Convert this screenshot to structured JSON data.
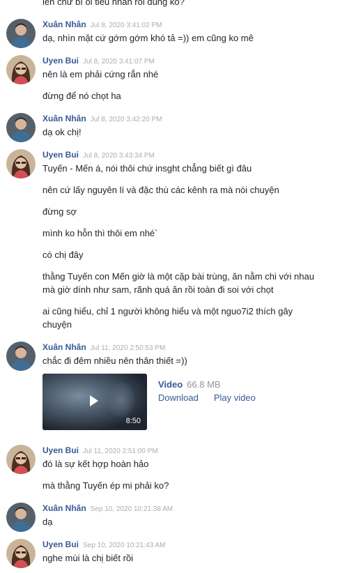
{
  "colors": {
    "name": "#385898",
    "time": "#a8acb3",
    "link": "#385898"
  },
  "groups": [
    {
      "sender": "",
      "time": "",
      "messages": [
        "lên chữ bí ổi tiểu nhân rồi đúng ko?"
      ]
    },
    {
      "sender": "Xuân Nhân",
      "time": "Jul 8, 2020 3:41:02 PM",
      "messages": [
        "dạ, nhìn mặt cứ gớm gớm khó tả =)) em cũng ko mê"
      ]
    },
    {
      "sender": "Uyen Bui",
      "time": "Jul 8, 2020 3:41:07 PM",
      "messages": [
        "nên là em phải cứng rắn nhé",
        "đừng để nó chọt ha"
      ]
    },
    {
      "sender": "Xuân Nhân",
      "time": "Jul 8, 2020 3:42:20 PM",
      "messages": [
        "dạ ok chị!"
      ]
    },
    {
      "sender": "Uyen Bui",
      "time": "Jul 8, 2020 3:43:34 PM",
      "messages": [
        "Tuyến - Mến á, nói thôi chứ insght chẳng biết gì đâu",
        "nên cứ lấy nguyên lí và đặc thù các kênh ra mà nói chuyện",
        "đừng sợ",
        "mình ko hỗn thì thôi em nhé`",
        "có chị đây",
        "thằng Tuyến con Mến giờ là một cặp bài trùng, ăn nằm chi với nhau mà giờ dính như sam, rãnh quá ăn rồi toàn đi soi với chọt",
        "ai cũng hiểu, chỉ 1 người không hiểu và một nguo7i2 thích gây chuyện"
      ]
    },
    {
      "sender": "Xuân Nhân",
      "time": "Jul 11, 2020 2:50:53 PM",
      "messages": [
        "chắc đi đêm nhiều nên thân thiết =))"
      ],
      "video": {
        "title": "Video",
        "size": "66.8 MB",
        "download": "Download",
        "play": "Play video",
        "duration": "8:50"
      }
    },
    {
      "sender": "Uyen Bui",
      "time": "Jul 11, 2020 2:51:00 PM",
      "messages": [
        "đó là sự kết hợp hoàn hảo",
        "mà thằng Tuyến ép mi phải ko?"
      ]
    },
    {
      "sender": "Xuân Nhân",
      "time": "Sep 10, 2020 10:21:38 AM",
      "messages": [
        "dạ"
      ]
    },
    {
      "sender": "Uyen Bui",
      "time": "Sep 10, 2020 10:21:43 AM",
      "messages": [
        "nghe mùi là chị biết rồi"
      ]
    }
  ]
}
